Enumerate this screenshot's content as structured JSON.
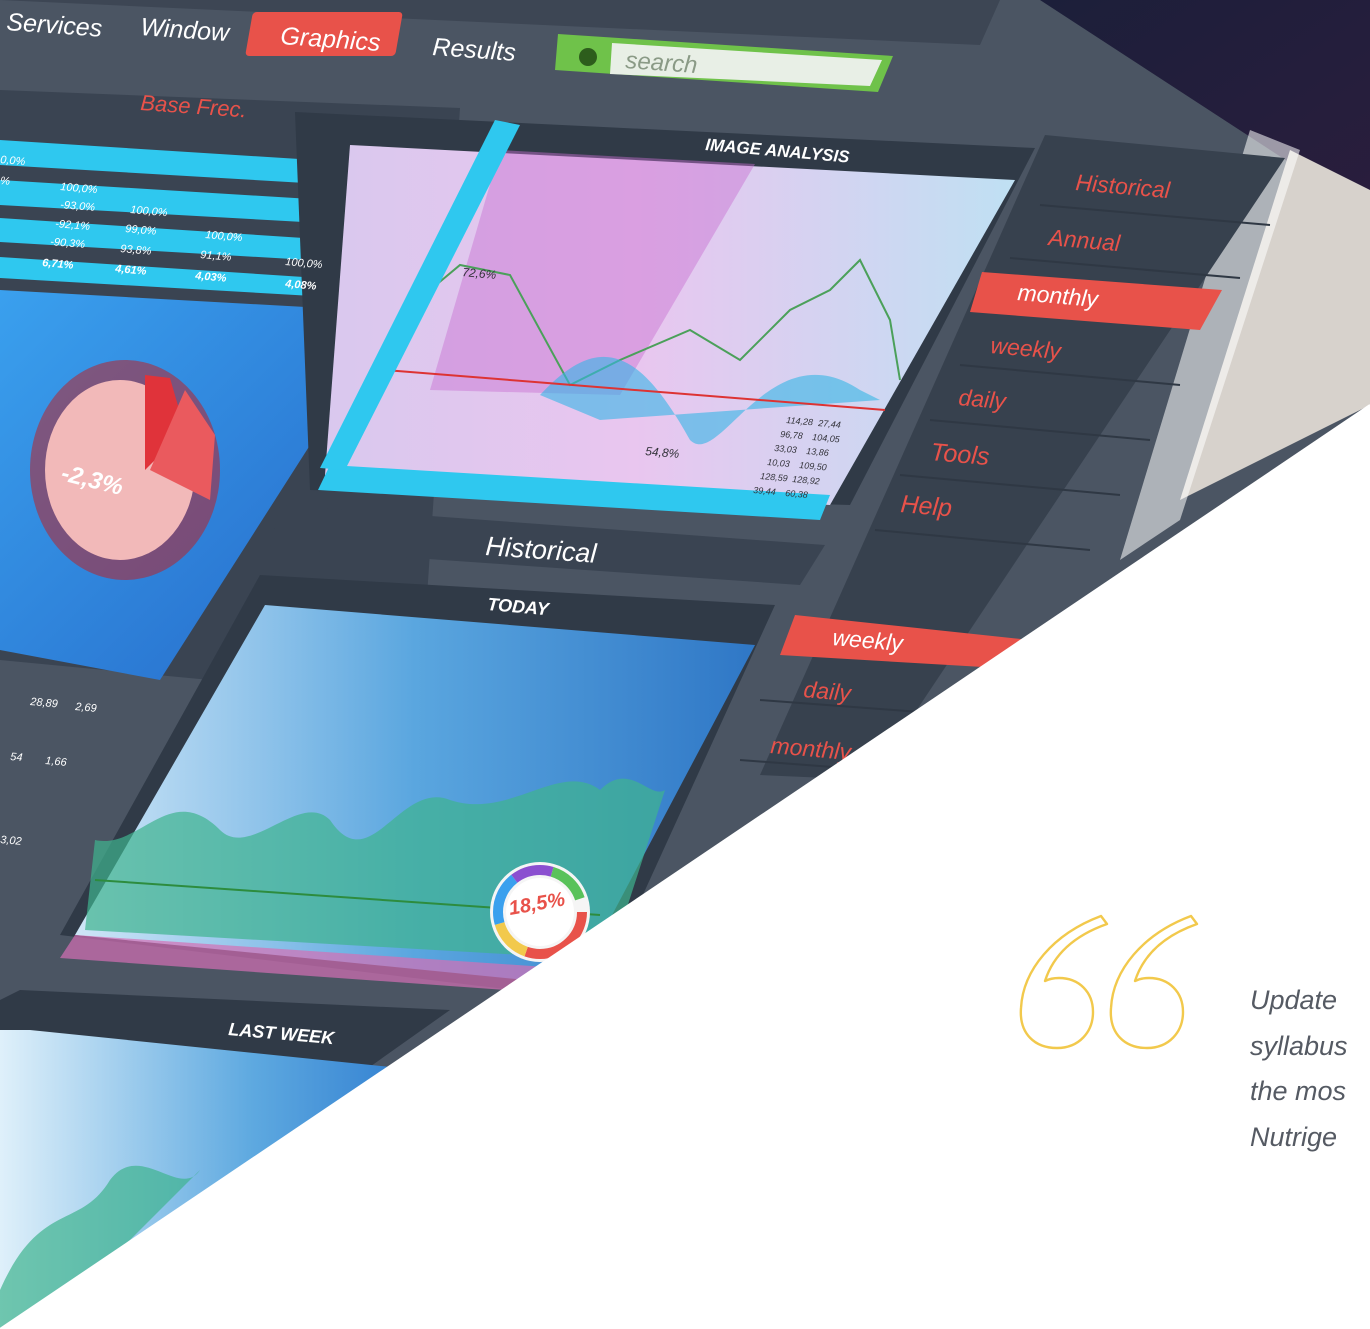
{
  "dashboard": {
    "menu": {
      "items": [
        "Services",
        "Window",
        "Graphics",
        "Results"
      ],
      "active": "Graphics",
      "search_placeholder": "search"
    },
    "panels": {
      "base_frec": {
        "title": "Base Frec.",
        "rows": [
          [
            "0,0%"
          ],
          [
            "%",
            "100,0%"
          ],
          [
            "-93,0%",
            "100,0%"
          ],
          [
            "-92,1%",
            "99,0%",
            "100,0%"
          ],
          [
            "-90,3%",
            "93,8%",
            "91,1%",
            "100,0%"
          ],
          [
            "6,71%",
            "4,61%",
            "4,03%",
            "4,08%"
          ]
        ],
        "pie_label": "-2,3%"
      },
      "image_analysis": {
        "title": "IMAGE ANALYSIS",
        "labels": [
          "72,6%",
          "54,8%"
        ],
        "values_table": [
          [
            "114,28",
            "27,44"
          ],
          [
            "96,78",
            "104,05"
          ],
          [
            "33,03",
            "13,86"
          ],
          [
            "10,03",
            "109,50"
          ],
          [
            "128,59",
            "128,92"
          ],
          [
            "39,44",
            "60,38"
          ]
        ]
      },
      "historical": {
        "title": "Historical",
        "today": "TODAY",
        "last_week": "LAST WEEK",
        "donut_label": "18,5%"
      },
      "lower_left_values": [
        "28,89",
        "2,69",
        "54",
        "1,66",
        "3,02"
      ]
    },
    "right_menu": {
      "items": [
        "Historical",
        "Annual",
        "monthly",
        "weekly",
        "daily",
        "Tools",
        "Help"
      ],
      "active": "monthly"
    },
    "sub_menu": {
      "items": [
        "weekly",
        "daily",
        "monthly"
      ],
      "active": "weekly"
    },
    "colors": {
      "panel_dark": "#3a4452",
      "accent_red": "#e8524a",
      "accent_cyan": "#2fc8ef",
      "search_green": "#6fc24a",
      "chart_blue": "#2b7fd8"
    }
  },
  "quote": {
    "lines": [
      "Update",
      "syllabus",
      "the mos",
      "Nutrige"
    ],
    "mark_color": "#f2c94c"
  }
}
